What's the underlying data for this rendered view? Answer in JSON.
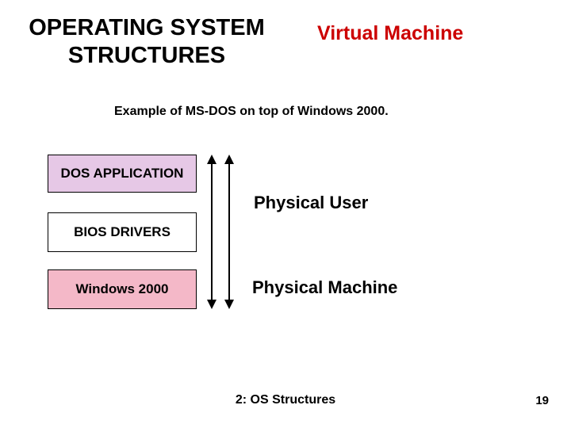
{
  "header": {
    "title_left": "OPERATING SYSTEM STRUCTURES",
    "title_right": "Virtual Machine"
  },
  "caption": "Example of MS-DOS on top of Windows 2000.",
  "boxes": {
    "app": "DOS APPLICATION",
    "bios": "BIOS DRIVERS",
    "os": "Windows 2000"
  },
  "labels": {
    "physical_user": "Physical User",
    "physical_machine": "Physical Machine"
  },
  "footer": {
    "center": "2: OS Structures",
    "pagenum": "19"
  },
  "colors": {
    "accent_red": "#cc0000",
    "box_app_bg": "#e6c8e6",
    "box_os_bg": "#f4b8c8"
  }
}
